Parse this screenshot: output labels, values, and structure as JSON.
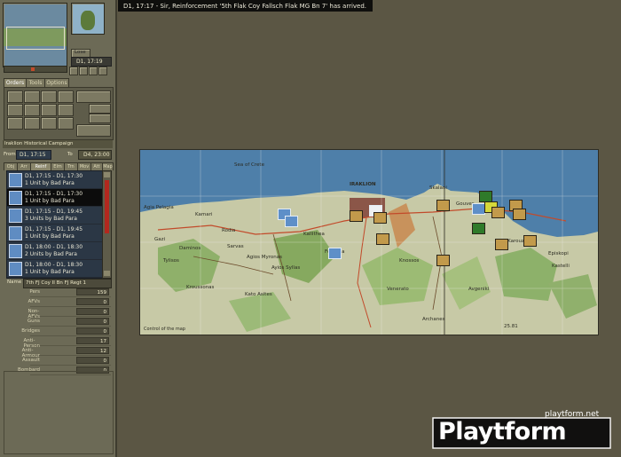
{
  "message_bar": {
    "text": "D1, 17:17 - Sir, Reinforcement '5th Flak Coy Fallsch Flak MG Bn 7' has arrived."
  },
  "clock": {
    "time": "D1, 17:19",
    "label": "Lose"
  },
  "tabs": [
    "Orders",
    "Tools",
    "Options"
  ],
  "campaign": {
    "title": "Iraklion Historical Campaign",
    "from_label": "From",
    "from": "D1, 17:15",
    "to_label": "To",
    "to": "D4, 23:00"
  },
  "subtabs": [
    "Obj",
    "Arr",
    "Reinf",
    "Elm",
    "Trn",
    "Mov",
    "Att",
    "Map"
  ],
  "events": [
    {
      "time": "D1, 17:15 - D1, 17:30",
      "desc": "1 Unit by Bad Para"
    },
    {
      "time": "D1, 17:15 - D1, 17:30",
      "desc": "1 Unit by Bad Para"
    },
    {
      "time": "D1, 17:15 - D1, 19:45",
      "desc": "3 Units by Bad Para"
    },
    {
      "time": "D1, 17:15 - D1, 19:45",
      "desc": "1 Unit by Bad Para"
    },
    {
      "time": "D1, 18:00 - D1, 18:30",
      "desc": "2 Units by Bad Para"
    },
    {
      "time": "D1, 18:00 - D1, 18:30",
      "desc": "1 Unit by Bad Para"
    }
  ],
  "unit_info": {
    "name_label": "Name",
    "name": "7th FJ Coy II Bn FJ Regt 1",
    "stats": [
      {
        "k": "Pers",
        "v": "159"
      },
      {
        "k": "AFVs",
        "v": "0"
      },
      {
        "k": "Non-AFVs",
        "v": "0"
      },
      {
        "k": "Guns",
        "v": "0"
      },
      {
        "k": "Bridges",
        "v": "0"
      },
      {
        "k": "Anti-Person",
        "v": "17"
      },
      {
        "k": "Anti-Armour",
        "v": "12"
      },
      {
        "k": "Assault",
        "v": "0"
      },
      {
        "k": "Bombard",
        "v": "0"
      }
    ]
  },
  "map": {
    "sea_label": "Sea of Crete",
    "towns": [
      {
        "n": "IRAKLION"
      },
      {
        "n": "Agia Pelagia"
      },
      {
        "n": "Kamari"
      },
      {
        "n": "Gazi"
      },
      {
        "n": "Rodia"
      },
      {
        "n": "Daminos"
      },
      {
        "n": "Kallithea"
      },
      {
        "n": "Sarvas"
      },
      {
        "n": "Tylisos"
      },
      {
        "n": "Agios Myronas"
      },
      {
        "n": "Ayios Syllas"
      },
      {
        "n": "Kroussonas"
      },
      {
        "n": "Knossos"
      },
      {
        "n": "Fortetsa"
      },
      {
        "n": "Kato Asites"
      },
      {
        "n": "Venerato"
      },
      {
        "n": "Archanes"
      },
      {
        "n": "Gouves"
      },
      {
        "n": "Episkopi"
      },
      {
        "n": "Kastelli"
      },
      {
        "n": "Avgeniki"
      },
      {
        "n": "Kato Karouzana"
      },
      {
        "n": "Skalani"
      }
    ],
    "status_left": "Control of the map",
    "coord_right": "25.81"
  },
  "watermark": {
    "text": "Playtform",
    "url": "playtform.net"
  }
}
